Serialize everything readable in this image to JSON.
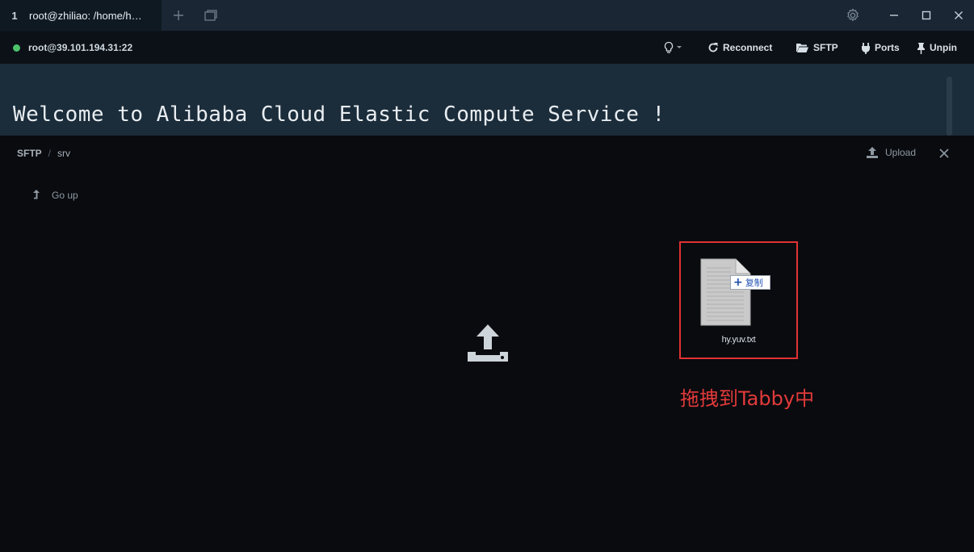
{
  "titlebar": {
    "tab_index": "1",
    "tab_title": "root@zhiliao: /home/h…",
    "icons": [
      "plus-icon",
      "window-icon",
      "gear-icon",
      "minimize-icon",
      "maximize-icon",
      "close-icon"
    ]
  },
  "toolbar": {
    "host": "root@39.101.194.31:22",
    "status_color": "#4cc36a",
    "reconnect_label": "Reconnect",
    "sftp_label": "SFTP",
    "ports_label": "Ports",
    "unpin_label": "Unpin"
  },
  "terminal": {
    "text": "Welcome to Alibaba Cloud Elastic Compute Service !"
  },
  "sftp": {
    "root_label": "SFTP",
    "separator": "/",
    "current_dir": "srv",
    "upload_label": "Upload",
    "go_up_label": "Go up"
  },
  "drag": {
    "badge_label": "复制",
    "badge_symbol": "+",
    "file_name": "hy.yuv.txt",
    "caption": "拖拽到Tabby中",
    "highlight_color": "#e23232"
  }
}
